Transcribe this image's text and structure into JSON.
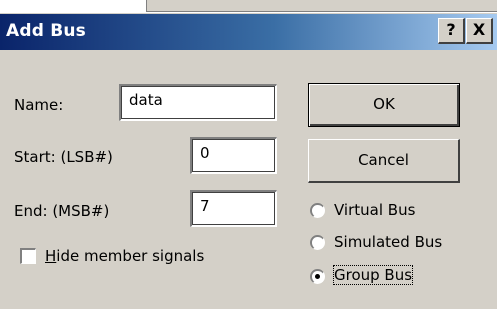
{
  "dialog": {
    "title": "Add Bus",
    "help_button": "?",
    "close_button": "X"
  },
  "form": {
    "name_label": "Name:",
    "name_value": "data",
    "start_label": "Start: (LSB#)",
    "start_value": "0",
    "end_label": "End: (MSB#)",
    "end_value": "7",
    "hide_checkbox_accel": "H",
    "hide_checkbox_rest": "ide member signals",
    "hide_checked": false
  },
  "buttons": {
    "ok": "OK",
    "cancel": "Cancel"
  },
  "bus_types": [
    {
      "label": "Virtual Bus",
      "selected": false
    },
    {
      "label": "Simulated Bus",
      "selected": false
    },
    {
      "label": "Group Bus",
      "selected": true
    }
  ],
  "colors": {
    "titlebar_start": "#0a246a",
    "titlebar_end": "#a6caf0",
    "face": "#d4d0c8"
  }
}
